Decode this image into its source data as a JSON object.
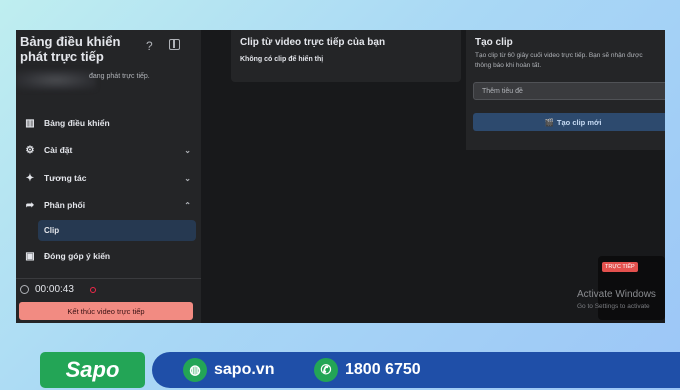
{
  "sidebar": {
    "title": "Bảng điều khiển phát trực tiếp",
    "help_icon": "question-icon",
    "status_text": "đang phát trực tiếp.",
    "items": [
      {
        "label": "Bảng điều khiển",
        "icon": "dashboard-icon"
      },
      {
        "label": "Cài đặt",
        "icon": "gear-icon",
        "chevron": "⌄"
      },
      {
        "label": "Tương tác",
        "icon": "sparkle-icon",
        "chevron": "⌄"
      },
      {
        "label": "Phân phối",
        "icon": "share-icon",
        "chevron": "⌃"
      },
      {
        "label": "Đóng góp ý kiến",
        "icon": "feedback-icon"
      }
    ],
    "sub_item": "Clip",
    "timer": "00:00:43",
    "end_button": "Kết thúc video trực tiếp"
  },
  "clips_card": {
    "title": "Clip từ video trực tiếp của bạn",
    "empty_text": "Không có clip để hiển thị"
  },
  "create_clip": {
    "title": "Tạo clip",
    "description_line1": "Tạo clip từ 60 giây cuối video trực tiếp. Bạn sẽ nhận được",
    "description_line2": "thông báo khi hoàn tất.",
    "title_placeholder": "Thêm tiêu đề",
    "button_label": "Tạo clip mới"
  },
  "live_preview": {
    "badge": "TRỰC TIẾP"
  },
  "watermark": {
    "line1": "Activate Windows",
    "line2": "Go to Settings to activate"
  },
  "footer": {
    "brand": "Sapo",
    "website": "sapo.vn",
    "phone": "1800 6750"
  },
  "colors": {
    "brand_green": "#23a556",
    "brand_blue": "#1f4fa8",
    "end_button": "#f28b82",
    "live_badge": "#e4514e"
  }
}
